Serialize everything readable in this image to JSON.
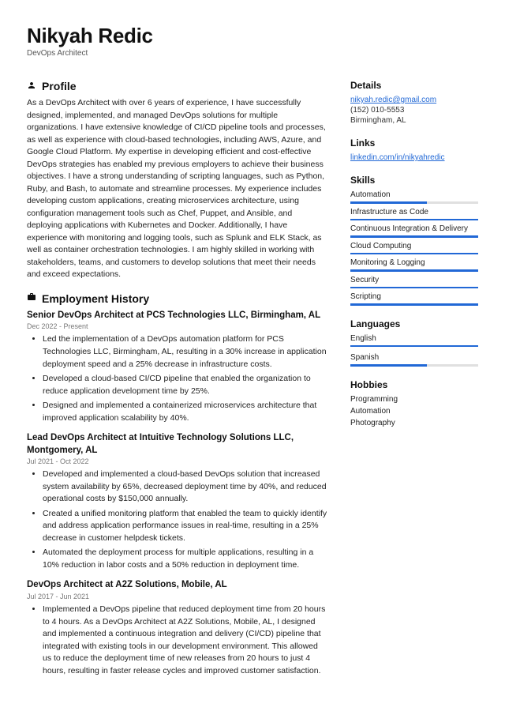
{
  "header": {
    "name": "Nikyah Redic",
    "subtitle": "DevOps Architect"
  },
  "profile": {
    "title": "Profile",
    "text": "As a DevOps Architect with over 6 years of experience, I have successfully designed, implemented, and managed DevOps solutions for multiple organizations. I have extensive knowledge of CI/CD pipeline tools and processes, as well as experience with cloud-based technologies, including AWS, Azure, and Google Cloud Platform. My expertise in developing efficient and cost-effective DevOps strategies has enabled my previous employers to achieve their business objectives. I have a strong understanding of scripting languages, such as Python, Ruby, and Bash, to automate and streamline processes. My experience includes developing custom applications, creating microservices architecture, using configuration management tools such as Chef, Puppet, and Ansible, and deploying applications with Kubernetes and Docker. Additionally, I have experience with monitoring and logging tools, such as Splunk and ELK Stack, as well as container orchestration technologies. I am highly skilled in working with stakeholders, teams, and customers to develop solutions that meet their needs and exceed expectations."
  },
  "employment": {
    "title": "Employment History",
    "jobs": [
      {
        "title": "Senior DevOps Architect at PCS Technologies LLC, Birmingham, AL",
        "date": "Dec 2022 - Present",
        "bullets": [
          "Led the implementation of a DevOps automation platform for PCS Technologies LLC, Birmingham, AL, resulting in a 30% increase in application deployment speed and a 25% decrease in infrastructure costs.",
          "Developed a cloud-based CI/CD pipeline that enabled the organization to reduce application development time by 25%.",
          "Designed and implemented a containerized microservices architecture that improved application scalability by 40%."
        ]
      },
      {
        "title": "Lead DevOps Architect at Intuitive Technology Solutions LLC, Montgomery, AL",
        "date": "Jul 2021 - Oct 2022",
        "bullets": [
          "Developed and implemented a cloud-based DevOps solution that increased system availability by 65%, decreased deployment time by 40%, and reduced operational costs by $150,000 annually.",
          "Created a unified monitoring platform that enabled the team to quickly identify and address application performance issues in real-time, resulting in a 25% decrease in customer helpdesk tickets.",
          "Automated the deployment process for multiple applications, resulting in a 10% reduction in labor costs and a 50% reduction in deployment time."
        ]
      },
      {
        "title": "DevOps Architect at A2Z Solutions, Mobile, AL",
        "date": "Jul 2017 - Jun 2021",
        "bullets": [
          "Implemented a DevOps pipeline that reduced deployment time from 20 hours to 4 hours. As a DevOps Architect at A2Z Solutions, Mobile, AL, I designed and implemented a continuous integration and delivery (CI/CD) pipeline that integrated with existing tools in our development environment. This allowed us to reduce the deployment time of new releases from 20 hours to just 4 hours, resulting in faster release cycles and improved customer satisfaction."
        ]
      }
    ]
  },
  "details": {
    "title": "Details",
    "email": "nikyah.redic@gmail.com",
    "phone": "(152) 010-5553",
    "location": "Birmingham, AL"
  },
  "links": {
    "title": "Links",
    "items": [
      "linkedin.com/in/nikyahredic"
    ]
  },
  "skills": {
    "title": "Skills",
    "items": [
      {
        "name": "Automation",
        "pct": 60
      },
      {
        "name": "Infrastructure as Code",
        "pct": 100
      },
      {
        "name": "Continuous Integration & Delivery",
        "pct": 100
      },
      {
        "name": "Cloud Computing",
        "pct": 100
      },
      {
        "name": "Monitoring & Logging",
        "pct": 100
      },
      {
        "name": "Security",
        "pct": 100
      },
      {
        "name": "Scripting",
        "pct": 100
      }
    ]
  },
  "languages": {
    "title": "Languages",
    "items": [
      {
        "name": "English",
        "pct": 100
      },
      {
        "name": "Spanish",
        "pct": 60
      }
    ]
  },
  "hobbies": {
    "title": "Hobbies",
    "items": [
      "Programming",
      "Automation",
      "Photography"
    ]
  }
}
